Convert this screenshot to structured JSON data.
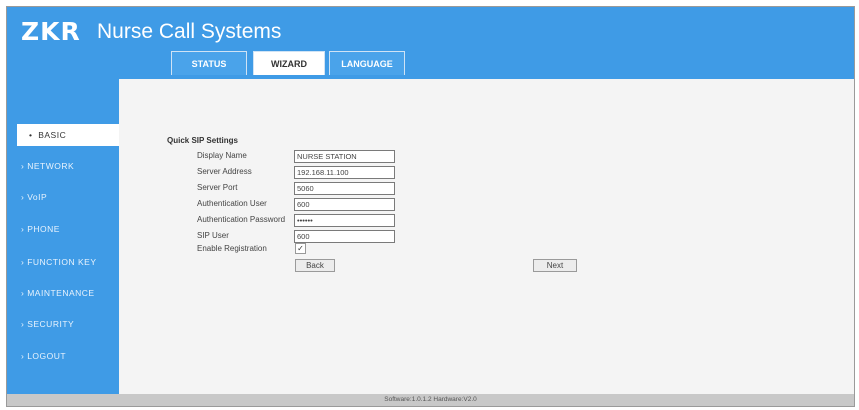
{
  "header": {
    "logo": "ZKR",
    "title": "Nurse Call Systems"
  },
  "tabs": [
    {
      "label": "STATUS",
      "active": false
    },
    {
      "label": "WIZARD",
      "active": true
    },
    {
      "label": "LANGUAGE",
      "active": false
    }
  ],
  "sidebar": {
    "items": [
      {
        "label": "BASIC",
        "active": true
      },
      {
        "label": "NETWORK"
      },
      {
        "label": "VoIP"
      },
      {
        "label": "PHONE"
      },
      {
        "label": "FUNCTION KEY"
      },
      {
        "label": "MAINTENANCE"
      },
      {
        "label": "SECURITY"
      },
      {
        "label": "LOGOUT"
      }
    ]
  },
  "form": {
    "section_title": "Quick SIP Settings",
    "fields": [
      {
        "label": "Display Name",
        "value": "NURSE STATION"
      },
      {
        "label": "Server Address",
        "value": "192.168.11.100"
      },
      {
        "label": "Server Port",
        "value": "5060"
      },
      {
        "label": "Authentication User",
        "value": "600"
      },
      {
        "label": "Authentication Password",
        "value": "••••••"
      },
      {
        "label": "SIP User",
        "value": "600"
      }
    ],
    "enable_registration": {
      "label": "Enable Registration",
      "checked": true,
      "mark": "✓"
    },
    "back_label": "Back",
    "next_label": "Next"
  },
  "footer": {
    "text": "Software:1.0.1.2 Hardware:V2.0"
  },
  "colors": {
    "brand_blue": "#3f9be6",
    "background": "#f4f4f4",
    "footer": "#c8c8c8"
  }
}
